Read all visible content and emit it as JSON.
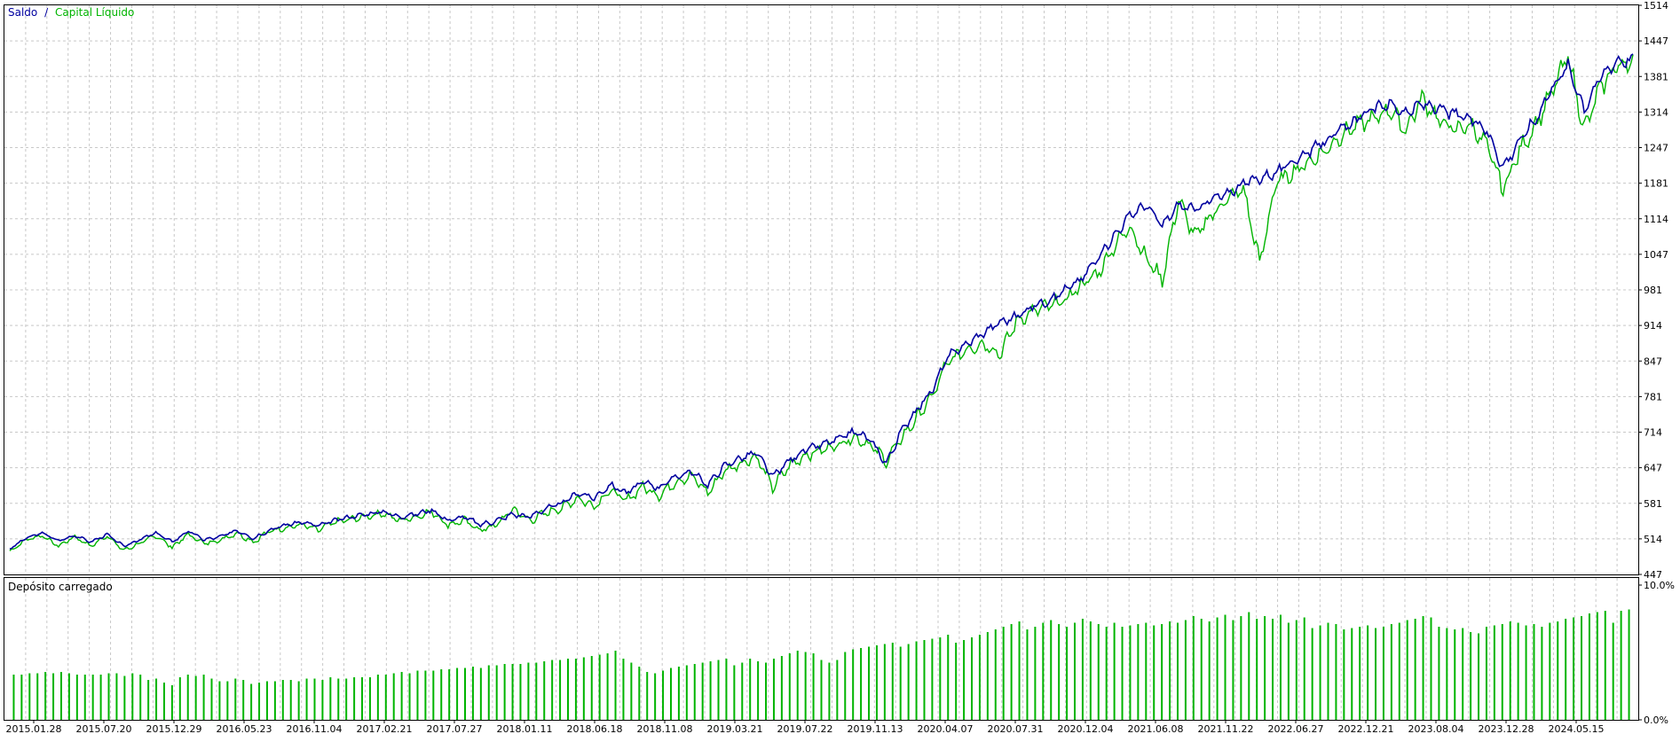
{
  "chart_data": [
    {
      "type": "line",
      "panel": "main",
      "legend": {
        "placement": "top-left",
        "separator": "/",
        "items": [
          {
            "label": "Saldo",
            "color": "#0000a0"
          },
          {
            "label": "Capital Líquido",
            "color": "#00b400"
          }
        ]
      },
      "ylim": [
        447,
        1514
      ],
      "y_ticks": [
        "1514",
        "1447",
        "1381",
        "1314",
        "1247",
        "1181",
        "1114",
        "1047",
        "981",
        "914",
        "847",
        "781",
        "714",
        "647",
        "581",
        "514",
        "447"
      ],
      "y_axis_position": "right",
      "grid": true,
      "series": [
        {
          "name": "Saldo",
          "color": "#0000a0",
          "t": [
            0,
            0.01,
            0.02,
            0.03,
            0.04,
            0.05,
            0.06,
            0.07,
            0.08,
            0.09,
            0.1,
            0.11,
            0.12,
            0.13,
            0.14,
            0.15,
            0.16,
            0.17,
            0.18,
            0.19,
            0.2,
            0.21,
            0.22,
            0.23,
            0.24,
            0.25,
            0.26,
            0.27,
            0.28,
            0.29,
            0.3,
            0.31,
            0.32,
            0.33,
            0.34,
            0.35,
            0.36,
            0.37,
            0.38,
            0.39,
            0.4,
            0.41,
            0.42,
            0.43,
            0.44,
            0.45,
            0.46,
            0.47,
            0.48,
            0.49,
            0.5,
            0.51,
            0.52,
            0.53,
            0.54,
            0.55,
            0.56,
            0.57,
            0.575,
            0.58,
            0.59,
            0.6,
            0.61,
            0.62,
            0.63,
            0.64,
            0.65,
            0.66,
            0.67,
            0.68,
            0.69,
            0.7,
            0.71,
            0.72,
            0.73,
            0.74,
            0.75,
            0.76,
            0.77,
            0.78,
            0.79,
            0.8,
            0.81,
            0.82,
            0.83,
            0.84,
            0.85,
            0.86,
            0.87,
            0.88,
            0.89,
            0.9,
            0.91,
            0.92,
            0.93,
            0.94,
            0.95,
            0.96,
            0.97,
            0.98,
            0.99,
            1
          ],
          "values": [
            495,
            515,
            525,
            510,
            520,
            508,
            522,
            500,
            512,
            525,
            508,
            528,
            512,
            518,
            530,
            515,
            530,
            540,
            545,
            538,
            548,
            555,
            560,
            565,
            555,
            560,
            568,
            548,
            555,
            540,
            548,
            560,
            555,
            570,
            580,
            600,
            590,
            615,
            600,
            620,
            610,
            630,
            640,
            615,
            650,
            665,
            675,
            630,
            660,
            680,
            690,
            700,
            715,
            700,
            655,
            720,
            760,
            800,
            840,
            860,
            880,
            900,
            920,
            930,
            950,
            960,
            980,
            1000,
            1040,
            1080,
            1120,
            1140,
            1100,
            1140,
            1130,
            1150,
            1160,
            1180,
            1190,
            1200,
            1220,
            1240,
            1260,
            1280,
            1300,
            1320,
            1330,
            1310,
            1330,
            1320,
            1310,
            1300,
            1280,
            1210,
            1260,
            1300,
            1360,
            1400,
            1320,
            1380,
            1410,
            1412
          ]
        },
        {
          "name": "Capital Líquido",
          "color": "#00b400",
          "t": [
            0,
            0.01,
            0.02,
            0.03,
            0.04,
            0.05,
            0.06,
            0.07,
            0.08,
            0.09,
            0.1,
            0.11,
            0.12,
            0.13,
            0.14,
            0.15,
            0.16,
            0.17,
            0.18,
            0.19,
            0.2,
            0.21,
            0.22,
            0.23,
            0.24,
            0.25,
            0.26,
            0.27,
            0.28,
            0.29,
            0.3,
            0.31,
            0.32,
            0.33,
            0.34,
            0.35,
            0.36,
            0.37,
            0.38,
            0.39,
            0.4,
            0.41,
            0.42,
            0.43,
            0.44,
            0.45,
            0.46,
            0.47,
            0.48,
            0.49,
            0.5,
            0.51,
            0.52,
            0.53,
            0.54,
            0.55,
            0.56,
            0.57,
            0.575,
            0.58,
            0.59,
            0.6,
            0.61,
            0.62,
            0.63,
            0.64,
            0.65,
            0.66,
            0.67,
            0.68,
            0.69,
            0.7,
            0.71,
            0.72,
            0.73,
            0.74,
            0.75,
            0.76,
            0.77,
            0.78,
            0.79,
            0.8,
            0.81,
            0.82,
            0.83,
            0.84,
            0.85,
            0.86,
            0.87,
            0.88,
            0.89,
            0.9,
            0.91,
            0.92,
            0.93,
            0.94,
            0.95,
            0.96,
            0.97,
            0.98,
            0.99,
            1
          ],
          "values": [
            490,
            512,
            520,
            500,
            518,
            500,
            520,
            492,
            505,
            520,
            498,
            522,
            505,
            512,
            525,
            508,
            528,
            535,
            540,
            530,
            545,
            550,
            556,
            562,
            548,
            555,
            565,
            540,
            548,
            530,
            540,
            570,
            548,
            562,
            572,
            590,
            575,
            605,
            585,
            612,
            595,
            620,
            632,
            600,
            640,
            655,
            668,
            610,
            650,
            670,
            680,
            690,
            705,
            690,
            660,
            705,
            745,
            790,
            830,
            850,
            870,
            880,
            860,
            920,
            940,
            950,
            960,
            990,
            1010,
            1060,
            1100,
            1040,
            1000,
            1150,
            1080,
            1120,
            1150,
            1170,
            1030,
            1180,
            1200,
            1220,
            1240,
            1270,
            1290,
            1300,
            1320,
            1280,
            1340,
            1300,
            1280,
            1290,
            1250,
            1170,
            1240,
            1290,
            1350,
            1420,
            1280,
            1360,
            1400,
            1410
          ]
        }
      ]
    },
    {
      "type": "bar",
      "panel": "sub",
      "title": "Depósito carregado",
      "color": "#00b400",
      "ylim": [
        0,
        10
      ],
      "y_ticks": [
        "10.0%",
        "0.0%"
      ],
      "y_axis_position": "right",
      "grid": true,
      "x_ticks": [
        "2015.01.28",
        "2015.07.20",
        "2015.12.29",
        "2016.05.23",
        "2016.11.04",
        "2017.02.21",
        "2017.07.27",
        "2018.01.11",
        "2018.06.18",
        "2018.11.08",
        "2019.03.21",
        "2019.07.22",
        "2019.11.13",
        "2020.04.07",
        "2020.07.31",
        "2020.12.04",
        "2021.06.08",
        "2021.11.22",
        "2022.06.27",
        "2022.12.21",
        "2023.08.04",
        "2023.12.28",
        "2024.05.15"
      ],
      "values": [
        3.4,
        3.4,
        3.5,
        3.5,
        3.6,
        3.5,
        3.6,
        3.5,
        3.4,
        3.4,
        3.4,
        3.4,
        3.5,
        3.5,
        3.3,
        3.5,
        3.4,
        3.0,
        3.1,
        2.8,
        2.6,
        3.2,
        3.4,
        3.3,
        3.4,
        3.1,
        2.9,
        2.9,
        3.1,
        3.0,
        2.7,
        2.8,
        2.9,
        2.9,
        3.0,
        3.0,
        2.9,
        3.1,
        3.1,
        3.0,
        3.2,
        3.1,
        3.1,
        3.2,
        3.2,
        3.2,
        3.4,
        3.4,
        3.5,
        3.6,
        3.5,
        3.7,
        3.7,
        3.7,
        3.8,
        3.8,
        3.9,
        3.9,
        4.0,
        3.9,
        4.1,
        4.1,
        4.2,
        4.2,
        4.2,
        4.3,
        4.3,
        4.4,
        4.5,
        4.5,
        4.6,
        4.6,
        4.7,
        4.8,
        4.9,
        5.0,
        5.2,
        4.6,
        4.3,
        4.0,
        3.6,
        3.5,
        3.7,
        3.9,
        4.0,
        4.1,
        4.2,
        4.3,
        4.4,
        4.5,
        4.6,
        4.1,
        4.3,
        4.6,
        4.4,
        4.3,
        4.6,
        4.8,
        5.0,
        5.2,
        5.1,
        5.0,
        4.5,
        4.3,
        4.5,
        5.1,
        5.3,
        5.4,
        5.5,
        5.6,
        5.7,
        5.8,
        5.5,
        5.7,
        5.9,
        6.0,
        6.1,
        6.2,
        6.4,
        5.8,
        6.0,
        6.2,
        6.4,
        6.6,
        6.8,
        7.0,
        7.2,
        7.4,
        6.8,
        7.0,
        7.3,
        7.5,
        7.2,
        7.0,
        7.3,
        7.6,
        7.4,
        7.2,
        7.0,
        7.3,
        7.0,
        7.1,
        7.2,
        7.3,
        7.1,
        7.2,
        7.4,
        7.3,
        7.5,
        7.8,
        7.6,
        7.4,
        7.7,
        7.9,
        7.5,
        7.8,
        8.1,
        7.6,
        7.8,
        7.6,
        7.9,
        7.3,
        7.5,
        7.7,
        6.9,
        7.1,
        7.3,
        7.2,
        6.8,
        6.9,
        7.0,
        7.1,
        6.9,
        7.0,
        7.2,
        7.3,
        7.5,
        7.6,
        7.8,
        7.7,
        7.0,
        6.9,
        6.8,
        6.9,
        6.6,
        6.5,
        7.0,
        7.1,
        7.2,
        7.4,
        7.3,
        7.1,
        7.2,
        7.0,
        7.3,
        7.4,
        7.6,
        7.7,
        7.8,
        8.0,
        8.1,
        8.2,
        7.3,
        8.2,
        8.3
      ]
    }
  ]
}
